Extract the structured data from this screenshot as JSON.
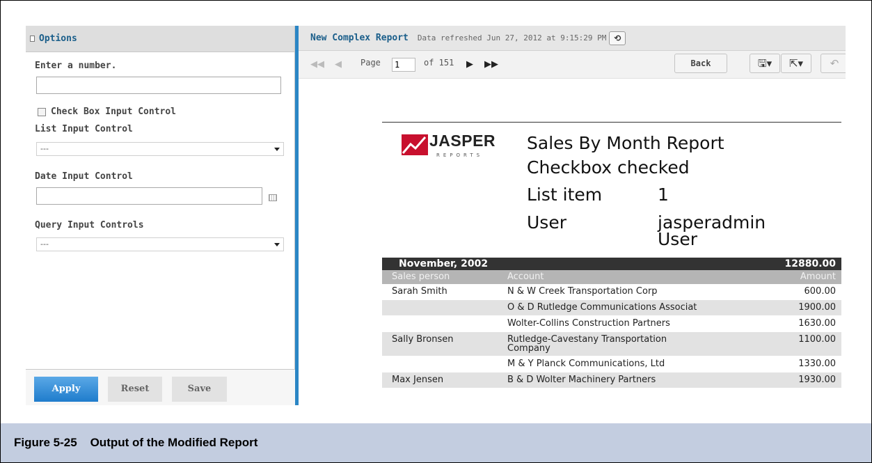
{
  "options": {
    "title": "Options",
    "number_label": "Enter a number.",
    "number_value": "",
    "checkbox_label": "Check Box Input Control",
    "checkbox_checked": false,
    "list_label": "List Input Control",
    "list_value": "---",
    "date_label": "Date Input Control",
    "date_value": "",
    "query_label": "Query Input Controls",
    "query_value": "---",
    "buttons": {
      "apply": "Apply",
      "reset": "Reset",
      "save": "Save"
    }
  },
  "viewer": {
    "report_title": "New Complex Report",
    "refreshed": "Data refreshed Jun 27, 2012 at 9:15:29 PM",
    "page_label": "Page",
    "page_value": "1",
    "page_of": "of 151",
    "back_label": "Back"
  },
  "report": {
    "logo_word": "JASPER",
    "logo_sub": "REPORTS",
    "heading": "Sales By Month Report",
    "line2": "Checkbox checked",
    "list_item_label": "List item",
    "list_item_value": "1",
    "user_label": "User",
    "user_value_1": "jasperadmin",
    "user_value_2": "User",
    "group_month": "November, 2002",
    "group_total": "12880.00",
    "columns": {
      "person": "Sales person",
      "account": "Account",
      "amount": "Amount"
    },
    "rows": [
      {
        "person": "Sarah Smith",
        "account": "N & W Creek Transportation Corp",
        "amount": "600.00"
      },
      {
        "person": "",
        "account": "O & D Rutledge Communications Associat",
        "amount": "1900.00"
      },
      {
        "person": "",
        "account": "Wolter-Collins Construction Partners",
        "amount": "1630.00"
      },
      {
        "person": "Sally Bronsen",
        "account_1": "Rutledge-Cavestany Transportation",
        "account_2": "Company",
        "amount": "1100.00"
      },
      {
        "person": "",
        "account": "M & Y Planck Communications, Ltd",
        "amount": "1330.00"
      },
      {
        "person": "Max Jensen",
        "account": "B & D Wolter Machinery Partners",
        "amount": "1930.00"
      }
    ]
  },
  "caption": "Figure 5-25    Output of the Modified Report"
}
